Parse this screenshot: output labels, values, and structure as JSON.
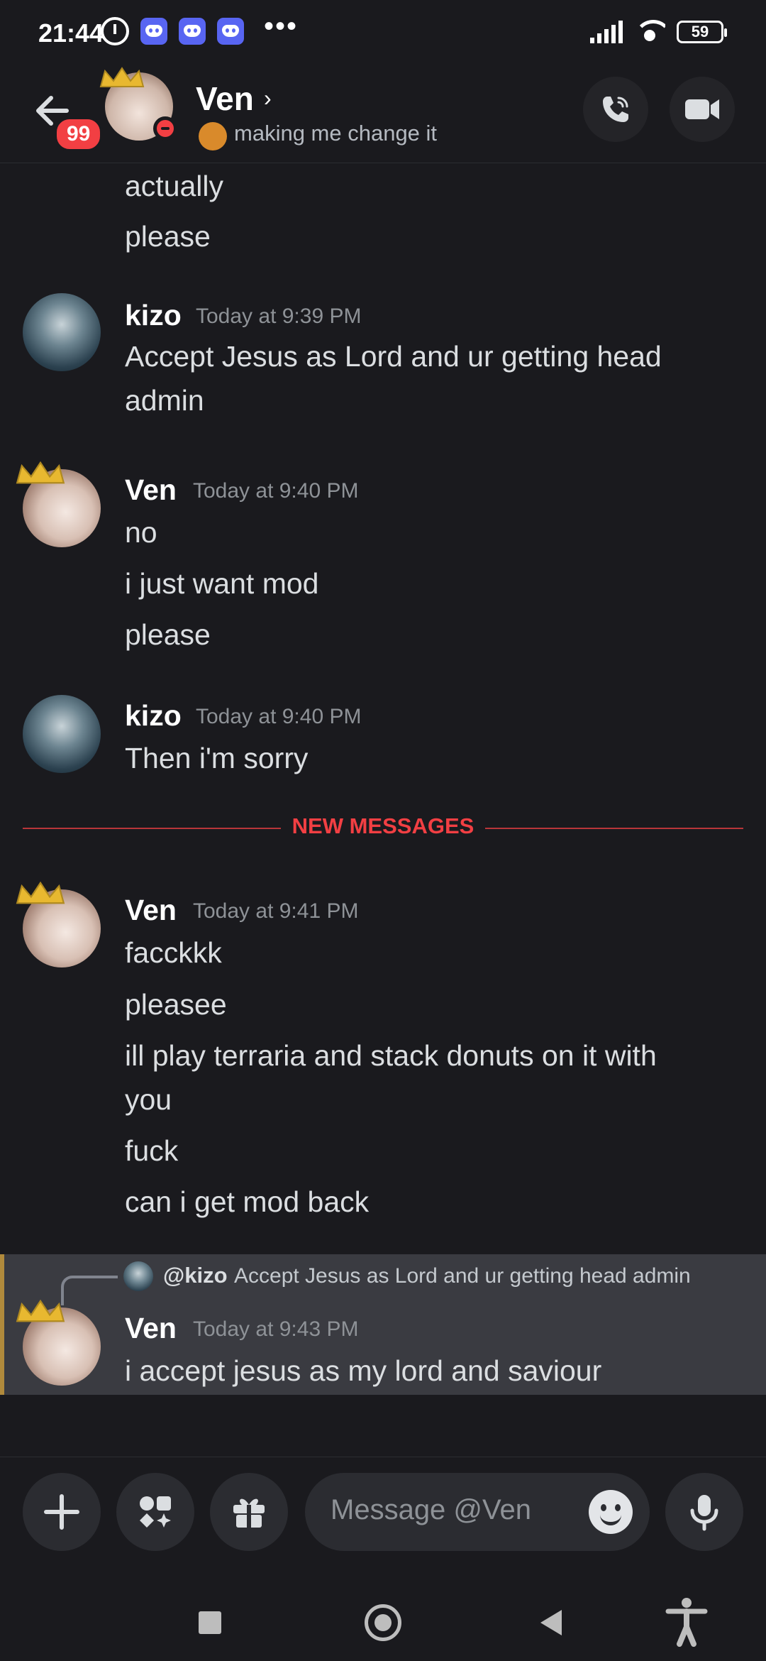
{
  "status_bar": {
    "time": "21:44",
    "battery": "59",
    "icons": [
      "alarm-icon",
      "discord-icon",
      "discord-icon",
      "discord-icon",
      "more-icon",
      "signal-icon",
      "wifi-icon",
      "battery-icon"
    ]
  },
  "header": {
    "unread_count": "99",
    "name": "Ven",
    "chevron": "›",
    "status_text": "making me change it"
  },
  "messages": {
    "continued": [
      "actually",
      "please"
    ],
    "g1": {
      "author": "kizo",
      "time": "Today at 9:39 PM",
      "lines": [
        "Accept Jesus as Lord and ur getting head",
        "admin"
      ]
    },
    "g2": {
      "author": "Ven",
      "time": "Today at 9:40 PM",
      "lines": [
        "no",
        "i just want mod",
        "please"
      ]
    },
    "g3": {
      "author": "kizo",
      "time": "Today at 9:40 PM",
      "lines": [
        "Then i'm sorry"
      ]
    },
    "divider": "NEW MESSAGES",
    "g4": {
      "author": "Ven",
      "time": "Today at 9:41 PM",
      "lines": [
        "facckkk",
        "pleasee",
        "ill play terraria and stack donuts on it with",
        "you",
        "fuck",
        "can i get mod back"
      ]
    },
    "g5": {
      "reply_author": "@kizo",
      "reply_text": "Accept Jesus as Lord and ur getting head admin",
      "author": "Ven",
      "time": "Today at 9:43 PM",
      "lines": [
        "i accept jesus as my lord and saviour"
      ]
    }
  },
  "input": {
    "placeholder": "Message @Ven"
  },
  "colors": {
    "background": "#1a1a1e",
    "accent_red": "#f23f43",
    "highlight": "#3a3b41",
    "mention_bar": "#b08a3c"
  }
}
